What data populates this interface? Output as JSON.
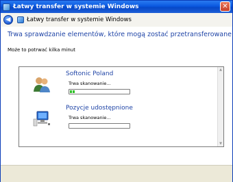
{
  "window": {
    "title": "Łatwy transfer w systemie Windows"
  },
  "nav": {
    "title": "Łatwy transfer w systemie Windows"
  },
  "page": {
    "heading": "Trwa sprawdzanie elementów, które mogą zostać przetransferowane...",
    "subtitle": "Może to potrwać kilka minut"
  },
  "items": [
    {
      "title": "Softonic Poland",
      "status": "Trwa skanowanie...",
      "icon": "users-icon",
      "progress_fraction": 0.1
    },
    {
      "title": "Pozycje udostępnione",
      "status": "Trwa skanowanie...",
      "icon": "shared-computer-icon",
      "progress_fraction": 0.0
    }
  ],
  "colors": {
    "accent": "#1f44a6",
    "progress": "#2fbf28",
    "titlebar": "#0a58e0"
  }
}
